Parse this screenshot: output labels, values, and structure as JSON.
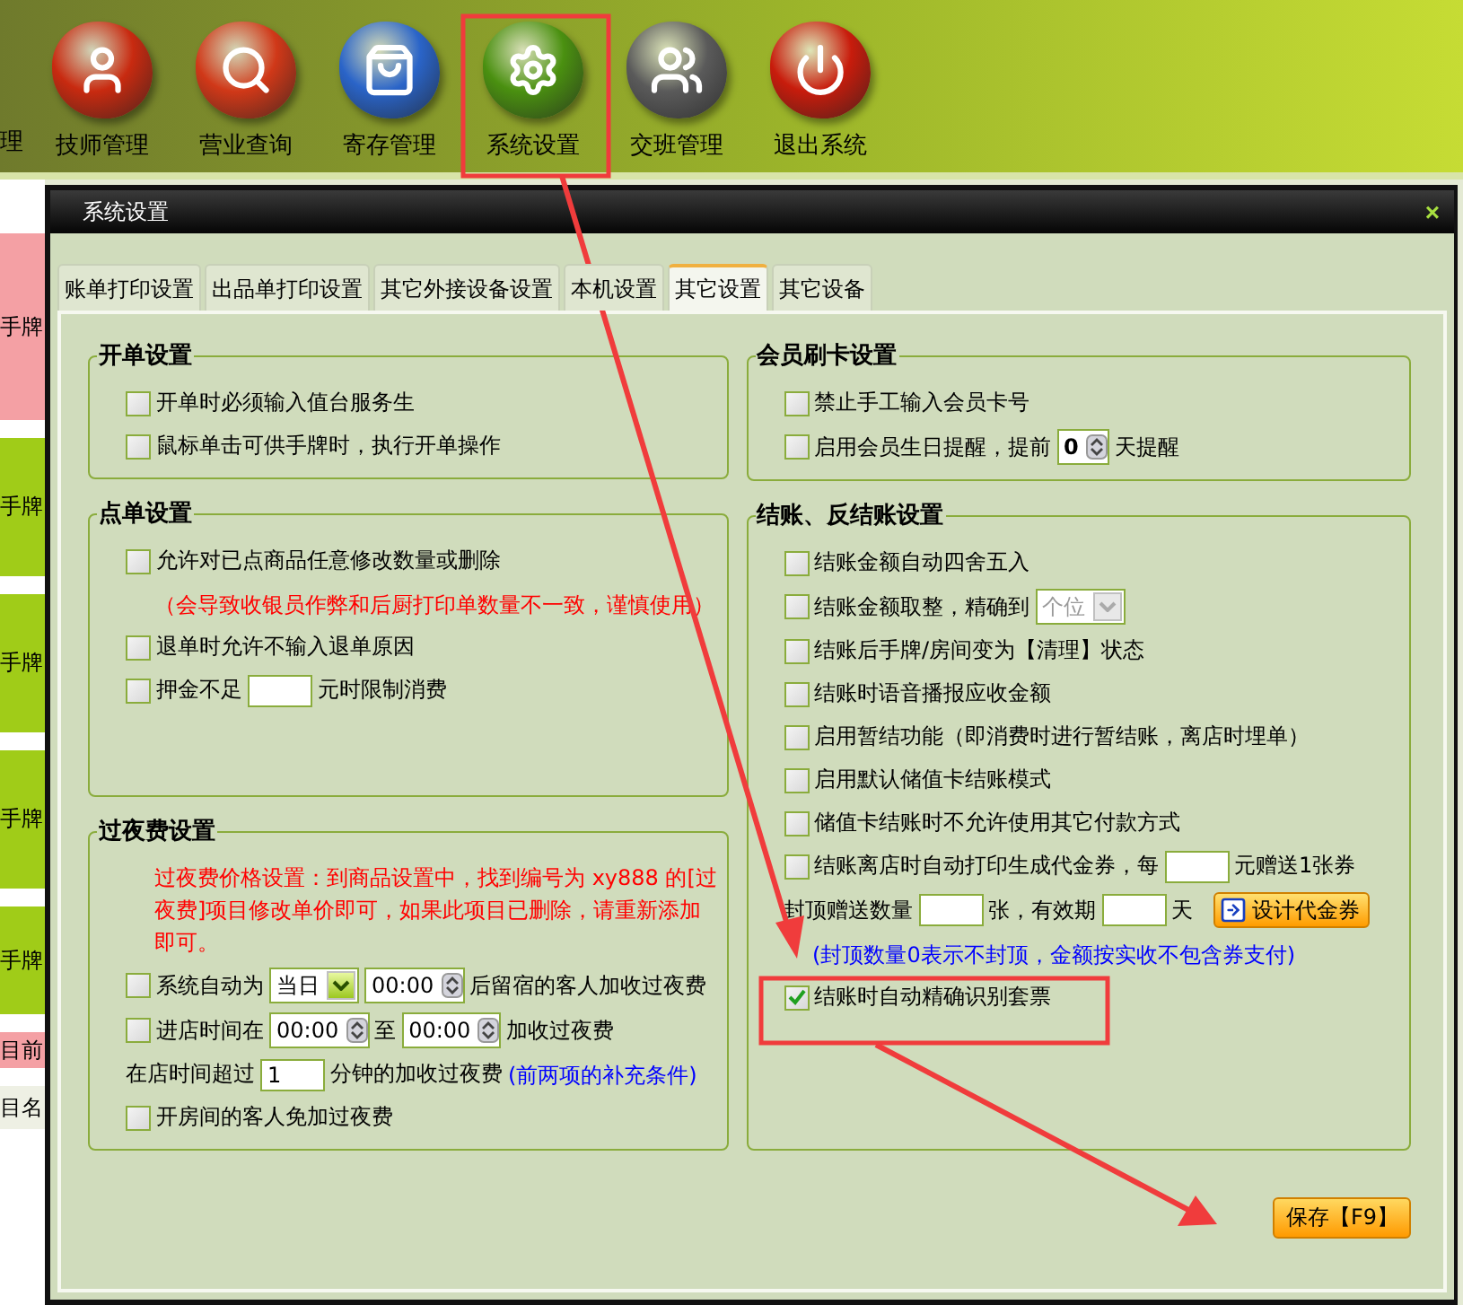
{
  "toolbar": {
    "cut_label": "理",
    "items": [
      {
        "label": "技师管理"
      },
      {
        "label": "营业查询"
      },
      {
        "label": "寄存管理"
      },
      {
        "label": "系统设置"
      },
      {
        "label": "交班管理"
      },
      {
        "label": "退出系统"
      }
    ]
  },
  "side_tiles": [
    {
      "label": "手牌",
      "color": "#f4a0a4"
    },
    {
      "label": "手牌",
      "color": "#a0cc18"
    },
    {
      "label": "手牌",
      "color": "#a0cc18"
    },
    {
      "label": "手牌",
      "color": "#a0cc18"
    },
    {
      "label": "手牌",
      "color": "#a0cc18"
    },
    {
      "label": "目前",
      "color": "#f4a0a4"
    },
    {
      "label": "目名",
      "color": "#eef0e4"
    }
  ],
  "dialog": {
    "title": "系统设置",
    "close": "×",
    "tabs": [
      {
        "label": "账单打印设置",
        "selected": false
      },
      {
        "label": "出品单打印设置",
        "selected": false
      },
      {
        "label": "其它外接设备设置",
        "selected": false
      },
      {
        "label": "本机设置",
        "selected": false
      },
      {
        "label": "其它设置",
        "selected": true
      },
      {
        "label": "其它设备",
        "selected": false
      }
    ],
    "columns": [
      {
        "groups": [
          {
            "title": "开单设置",
            "rows": [
              {
                "parts": [
                  {
                    "kind": "checkbox",
                    "label": "开单时必须输入值台服务生",
                    "checked": false
                  }
                ]
              },
              {
                "parts": [
                  {
                    "kind": "checkbox",
                    "label": "鼠标单击可供手牌时，执行开单操作",
                    "checked": false
                  }
                ]
              }
            ]
          },
          {
            "title": "点单设置",
            "rows": [
              {
                "parts": [
                  {
                    "kind": "checkbox",
                    "label": "允许对已点商品任意修改数量或删除",
                    "checked": false
                  }
                ]
              },
              {
                "parts": [
                  {
                    "kind": "note",
                    "text": "（会导致收银员作弊和后厨打印单数量不一致，谨慎使用）",
                    "color": "#ff0000"
                  }
                ]
              },
              {
                "parts": [
                  {
                    "kind": "checkbox",
                    "label": "退单时允许不输入退单原因",
                    "checked": false
                  }
                ]
              },
              {
                "parts": [
                  {
                    "kind": "checkbox",
                    "label": "押金不足",
                    "checked": false
                  },
                  {
                    "kind": "input"
                  },
                  {
                    "kind": "text",
                    "text": "元时限制消费"
                  }
                ]
              }
            ]
          },
          {
            "title": "过夜费设置",
            "rows": [
              {
                "parts": [
                  {
                    "kind": "note",
                    "text": "过夜费价格设置：到商品设置中，找到编号为 xy888 的[过夜费]项目修改单价即可，如果此项目已删除，请重新添加即可。",
                    "color": "#ff0000"
                  }
                ]
              },
              {
                "parts": [
                  {
                    "kind": "checkbox",
                    "label": "系统自动为",
                    "checked": false
                  },
                  {
                    "kind": "select",
                    "value": "当日",
                    "disabled": false
                  },
                  {
                    "kind": "time",
                    "value": "00:00"
                  },
                  {
                    "kind": "text",
                    "text": "后留宿的客人加收过夜费"
                  }
                ]
              },
              {
                "parts": [
                  {
                    "kind": "checkbox",
                    "label": "进店时间在",
                    "checked": false
                  },
                  {
                    "kind": "time",
                    "value": "00:00"
                  },
                  {
                    "kind": "text",
                    "text": "至"
                  },
                  {
                    "kind": "time",
                    "value": "00:00"
                  },
                  {
                    "kind": "text",
                    "text": "加收过夜费"
                  }
                ]
              },
              {
                "parts": [
                  {
                    "kind": "text",
                    "text": "在店时间超过"
                  },
                  {
                    "kind": "input",
                    "value": "1"
                  },
                  {
                    "kind": "text",
                    "text": "分钟的加收过夜费"
                  },
                  {
                    "kind": "note",
                    "text": "(前两项的补充条件)",
                    "color": "#0000ff"
                  }
                ]
              },
              {
                "parts": [
                  {
                    "kind": "checkbox",
                    "label": "开房间的客人免加过夜费",
                    "checked": false
                  }
                ]
              }
            ]
          }
        ]
      },
      {
        "groups": [
          {
            "title": "会员刷卡设置",
            "rows": [
              {
                "parts": [
                  {
                    "kind": "checkbox",
                    "label": "禁止手工输入会员卡号",
                    "checked": false
                  }
                ]
              },
              {
                "parts": [
                  {
                    "kind": "checkbox",
                    "label": "启用会员生日提醒，提前",
                    "checked": false
                  },
                  {
                    "kind": "spinner",
                    "value": "0"
                  },
                  {
                    "kind": "text",
                    "text": "天提醒"
                  }
                ]
              }
            ]
          },
          {
            "title": "结账、反结账设置",
            "rows": [
              {
                "parts": [
                  {
                    "kind": "checkbox",
                    "label": "结账金额自动四舍五入",
                    "checked": false
                  }
                ]
              },
              {
                "parts": [
                  {
                    "kind": "checkbox",
                    "label": "结账金额取整，精确到",
                    "checked": false
                  },
                  {
                    "kind": "select",
                    "value": "个位",
                    "disabled": true
                  }
                ]
              },
              {
                "parts": [
                  {
                    "kind": "checkbox",
                    "label": "结账后手牌/房间变为【清理】状态",
                    "checked": false
                  }
                ]
              },
              {
                "parts": [
                  {
                    "kind": "checkbox",
                    "label": "结账时语音播报应收金额",
                    "checked": false
                  }
                ]
              },
              {
                "parts": [
                  {
                    "kind": "checkbox",
                    "label": "启用暂结功能（即消费时进行暂结账，离店时埋单）",
                    "checked": false
                  }
                ]
              },
              {
                "parts": [
                  {
                    "kind": "checkbox",
                    "label": "启用默认储值卡结账模式",
                    "checked": false
                  }
                ]
              },
              {
                "parts": [
                  {
                    "kind": "checkbox",
                    "label": "储值卡结账时不允许使用其它付款方式",
                    "checked": false
                  }
                ]
              },
              {
                "parts": [
                  {
                    "kind": "checkbox",
                    "label": "结账离店时自动打印生成代金券，每",
                    "checked": false
                  },
                  {
                    "kind": "input"
                  },
                  {
                    "kind": "text",
                    "text": "元赠送1张券"
                  }
                ]
              },
              {
                "parts": [
                  {
                    "kind": "text",
                    "text": "封顶赠送数量"
                  },
                  {
                    "kind": "input"
                  },
                  {
                    "kind": "text",
                    "text": "张，有效期"
                  },
                  {
                    "kind": "input"
                  },
                  {
                    "kind": "text",
                    "text": "天"
                  },
                  {
                    "kind": "button",
                    "label": "设计代金券"
                  }
                ]
              },
              {
                "parts": [
                  {
                    "kind": "note",
                    "text": "(封顶数量0表示不封顶，金额按实收不包含券支付)",
                    "color": "#0000ff"
                  }
                ]
              },
              {
                "parts": [
                  {
                    "kind": "checkbox",
                    "label": "结账时自动精确识别套票",
                    "checked": true
                  }
                ]
              }
            ]
          }
        ]
      }
    ],
    "save": "保存【F9】"
  }
}
